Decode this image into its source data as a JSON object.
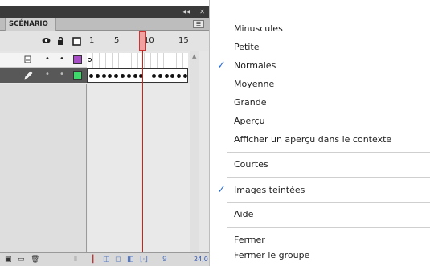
{
  "panel": {
    "tab_label": "SCÉNARIO",
    "controls_label": "◂◂ | ✕",
    "menu_button": "☰",
    "ruler": [
      "1",
      "5",
      "10",
      "15"
    ],
    "footer_fps": "24,0"
  },
  "colors": {
    "layer1_swatch": "#a84fc8",
    "layer2_swatch": "#3fd86a",
    "playhead": "#d0201a",
    "check": "#2a6bd0"
  },
  "menu": {
    "items": [
      {
        "label": "Minuscules",
        "checked": false
      },
      {
        "label": "Petite",
        "checked": false
      },
      {
        "label": "Normales",
        "checked": true
      },
      {
        "label": "Moyenne",
        "checked": false
      },
      {
        "label": "Grande",
        "checked": false
      },
      {
        "label": "Aperçu",
        "checked": false
      },
      {
        "label": "Afficher un aperçu dans le contexte",
        "checked": false
      },
      {
        "label": "Courtes",
        "checked": false
      },
      {
        "label": "Images teintées",
        "checked": true
      },
      {
        "label": "Aide",
        "checked": false
      },
      {
        "label": "Fermer",
        "checked": false
      },
      {
        "label": "Fermer le groupe",
        "checked": false
      }
    ],
    "check_glyph": "✓"
  }
}
